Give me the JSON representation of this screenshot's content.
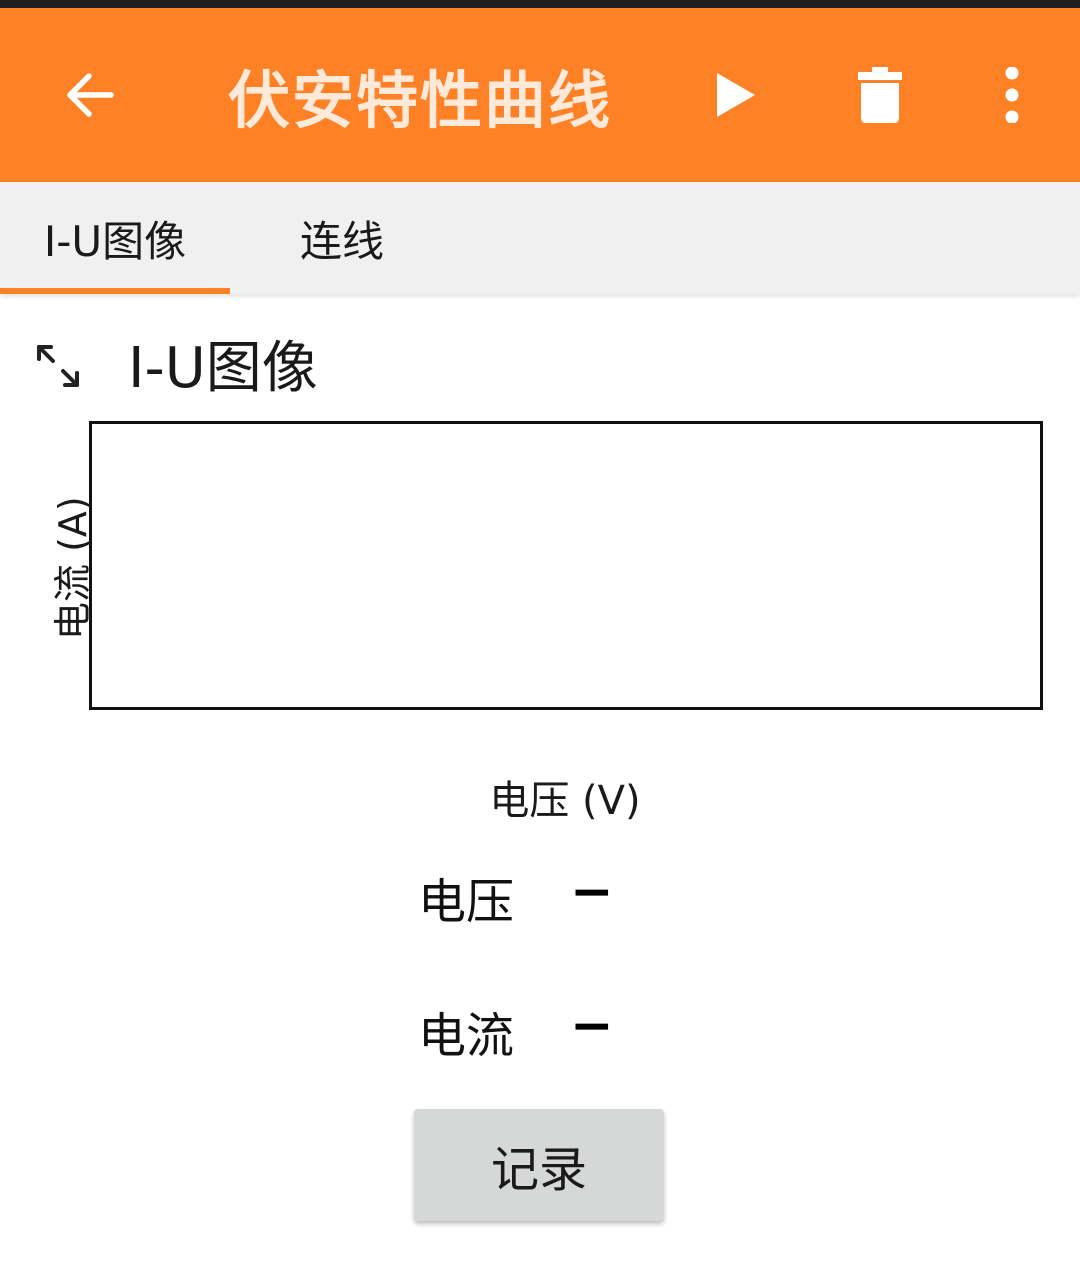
{
  "app_bar": {
    "title": "伏安特性曲线",
    "back_icon": "arrow-back-icon",
    "play_icon": "play-icon",
    "delete_icon": "trash-icon",
    "menu_icon": "more-vertical-icon",
    "background_color": "#ff8126"
  },
  "tabs": [
    {
      "label": "I-U图像",
      "selected": true
    },
    {
      "label": "连线",
      "selected": false
    }
  ],
  "section": {
    "title": "I-U图像",
    "expand_icon": "expand-arrows-icon"
  },
  "chart": {
    "y_axis_label": "电流 (A)",
    "x_axis_label": "电压 (V)"
  },
  "readings": {
    "voltage_label": "电压",
    "voltage_value": "−",
    "current_label": "电流",
    "current_value": "−"
  },
  "record_button": {
    "label": "记录"
  },
  "accent_color": "#ff8126"
}
